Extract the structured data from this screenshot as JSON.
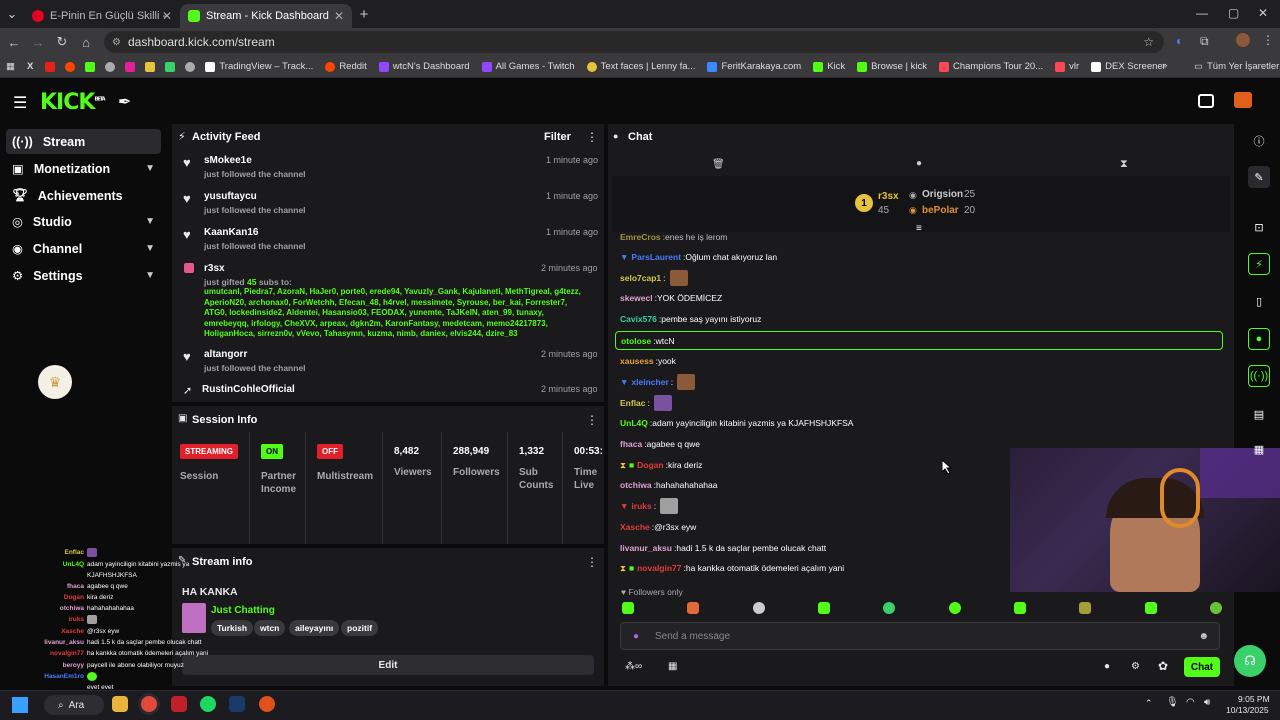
{
  "browser": {
    "tabs": [
      {
        "title": "E-Pinin En Güçlü Skilli - Pindirin",
        "active": false
      },
      {
        "title": "Stream - Kick Dashboard",
        "active": true
      }
    ],
    "url": "dashboard.kick.com/stream",
    "bookmarks": [
      "TradingView – Track...",
      "Reddit",
      "wtcN's Dashboard",
      "All Games - Twitch",
      "Text faces | Lenny fa...",
      "FeritKarakaya.com",
      "Kick",
      "Browse | kick",
      "Champions Tour 20...",
      "vlr",
      "DEX Screener"
    ],
    "all_bookmarks": "Tüm Yer İşaretleri"
  },
  "kick": {
    "logo": "KICK",
    "logo_sup": "BETA"
  },
  "sidebar": {
    "items": [
      {
        "label": "Stream",
        "icon": "stream-icon",
        "active": true,
        "chevron": false
      },
      {
        "label": "Monetization",
        "icon": "monetization-icon",
        "active": false,
        "chevron": true
      },
      {
        "label": "Achievements",
        "icon": "trophy-icon",
        "active": false,
        "chevron": false
      },
      {
        "label": "Studio",
        "icon": "studio-icon",
        "active": false,
        "chevron": true
      },
      {
        "label": "Channel",
        "icon": "channel-icon",
        "active": false,
        "chevron": true
      },
      {
        "label": "Settings",
        "icon": "gear-icon",
        "active": false,
        "chevron": true
      }
    ]
  },
  "activity": {
    "title": "Activity Feed",
    "filter": "Filter",
    "items": [
      {
        "name": "sMokee1e",
        "sub": "just followed the channel",
        "time": "1 minute ago",
        "icon": "heart-icon"
      },
      {
        "name": "yusuftaycu",
        "sub": "just followed the channel",
        "time": "1 minute ago",
        "icon": "heart-icon"
      },
      {
        "name": "KaanKan16",
        "sub": "just followed the channel",
        "time": "1 minute ago",
        "icon": "heart-icon"
      },
      {
        "name": "r3sx",
        "sub": "just gifted",
        "count": "45",
        "sub2": "subs to:",
        "time": "2 minutes ago",
        "icon": "gift-icon"
      },
      {
        "name": "altangorr",
        "sub": "just followed the channel",
        "time": "2 minutes ago",
        "icon": "heart-icon"
      },
      {
        "name": "RustinCohleOfficial",
        "sub": "",
        "time": "2 minutes ago",
        "icon": "host-icon"
      }
    ],
    "gifted_list": "umutcanl, Piedra7, AzoraN, HaJer0, porte0, erede94, Yavuzly_Gank, Kajulaneti, MethTigreal, g4tezz, AperioN20, archonax0, ForWetchh, Efecan_48, h4rvel, messimete, Syrouse, ber_kai, Forrester7, ATG0, lockedinside2, Aldentei, Hasansio03, FEODAX, yunemte, TaJKeIN, aten_99, tunaxy, emrebeyqq, irfology, CheXVX, arpeax, dgkn2m, KaronFantasy, medetcam, memo24217873, HoliganHoca, sirrezn0v, vVevo, Tahasymn, kuzma, nimb, daniex, elvis244, dzire_83"
  },
  "session": {
    "title": "Session Info",
    "streaming": "STREAMING",
    "session_label": "Session",
    "on": "ON",
    "partner": "Partner Income",
    "off": "OFF",
    "multistream": "Multistream",
    "viewers": "8,482",
    "viewers_label": "Viewers",
    "followers": "288,949",
    "followers_label": "Followers",
    "subs": "1,332",
    "subs_label": "Sub Counts",
    "time": "00:53:",
    "time_label": "Time Live"
  },
  "stream_info": {
    "title": "Stream info",
    "stream_title": "HA KANKA",
    "category": "Just Chatting",
    "tags": [
      "Turkish",
      "wtcn",
      "aileyayını",
      "pozitif"
    ],
    "edit": "Edit"
  },
  "chat": {
    "title": "Chat",
    "leaderboard": [
      {
        "rank": "1",
        "name": "r3sx",
        "count": "45"
      },
      {
        "name": "Origsion",
        "count": "25"
      },
      {
        "name": "bePolar",
        "count": "20"
      }
    ],
    "messages": [
      {
        "user": "EmreCros",
        "color": "#d4c94a",
        "text": "enes he iş lerom"
      },
      {
        "user": "ParsLaurent",
        "color": "#4a7cff",
        "text": "Oğlum chat akıyoruz lan"
      },
      {
        "user": "selo7cap1",
        "color": "#d4c94a",
        "text": "",
        "emote": true
      },
      {
        "user": "skewecl",
        "color": "#e0a0d0",
        "text": "YOK ÖDEMİCEZ"
      },
      {
        "user": "Cavix576",
        "color": "#3ad0a0",
        "text": "pembe saş yayını istiyoruz"
      },
      {
        "user": "otolose",
        "color": "#53fc18",
        "text": "wtcN",
        "highlight": true
      },
      {
        "user": "xausess",
        "color": "#e6a23c",
        "text": "yook"
      },
      {
        "user": "xleincher",
        "color": "#4a7cff",
        "text": "",
        "emote": true
      },
      {
        "user": "Enflac",
        "color": "#d4c94a",
        "text": "",
        "emote": true
      },
      {
        "user": "UnL4Q",
        "color": "#53fc18",
        "text": "adam yayinciligin kitabini yazmis ya KJAFHSHJKFSA"
      },
      {
        "user": "fhaca",
        "color": "#e0a0d0",
        "text": "agabee q qwe"
      },
      {
        "user": "Dogan",
        "color": "#e23c3c",
        "text": "kira deriz"
      },
      {
        "user": "otchiwa",
        "color": "#e0a0d0",
        "text": "hahahahahahaa"
      },
      {
        "user": "iruks",
        "color": "#e23c3c",
        "text": "",
        "emote": true
      },
      {
        "user": "Xasche",
        "color": "#e23c3c",
        "text": "@r3sx eyw"
      },
      {
        "user": "livanur_aksu",
        "color": "#e0a0d0",
        "text": "hadi 1.5 k da saçlar pembe olucak chatt"
      },
      {
        "user": "novalgin77",
        "color": "#e23c3c",
        "text": "ha kankka otomatik ödemeleri açalım yani"
      }
    ],
    "followers_only": "Followers only",
    "placeholder": "Send a message",
    "send": "Chat"
  },
  "overlay": [
    {
      "u": "Enflac",
      "t": ""
    },
    {
      "u": "UnL4Q",
      "t": "adam yayinciligin kitabini yazmis ya"
    },
    {
      "u": "",
      "t": "KJAFHSHJKFSA"
    },
    {
      "u": "fhaca",
      "t": "agabee q qwe"
    },
    {
      "u": "Dogan",
      "t": "kira deriz"
    },
    {
      "u": "otchiwa",
      "t": "hahahahahahaa"
    },
    {
      "u": "iruks",
      "t": ""
    },
    {
      "u": "Xasche",
      "t": "@r3sx eyw"
    },
    {
      "u": "livanur_aksu",
      "t": "hadi 1.5 k da saçlar pembe olucak chatt"
    },
    {
      "u": "novalgin77",
      "t": "ha kankka otomatik ödemeleri açalım yani"
    },
    {
      "u": "beroyy",
      "t": "paycell ile abone olabiliyor muyuz"
    },
    {
      "u": "HasanEm1ro",
      "t": ""
    },
    {
      "u": "",
      "t": "evet evet"
    }
  ],
  "taskbar": {
    "search": "Ara",
    "time": "9:05 PM",
    "date": "10/13/2025"
  }
}
